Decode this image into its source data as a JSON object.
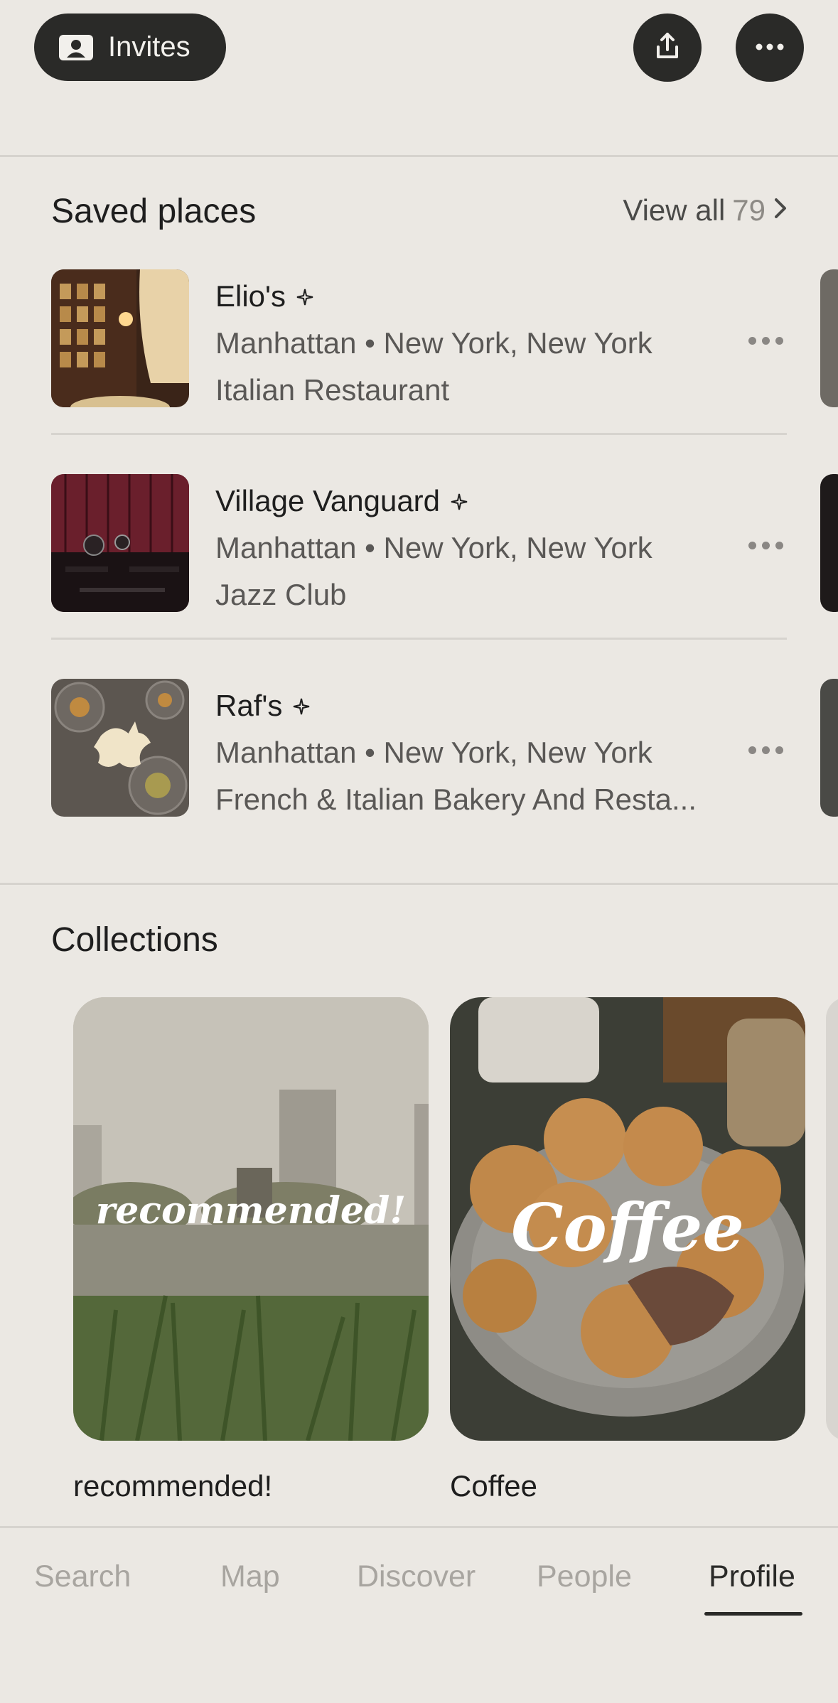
{
  "header": {
    "invites_label": "Invites",
    "icons": [
      "contact-card-icon",
      "share-icon",
      "more-icon"
    ]
  },
  "saved_places": {
    "title": "Saved places",
    "view_all_label": "View all",
    "view_all_count": "79",
    "items": [
      {
        "name": "Elio's",
        "location": "Manhattan • New York, New York",
        "category": "Italian Restaurant"
      },
      {
        "name": "Village Vanguard",
        "location": "Manhattan • New York, New York",
        "category": "Jazz Club"
      },
      {
        "name": "Raf's",
        "location": "Manhattan • New York, New York",
        "category": "French & Italian Bakery And Resta..."
      }
    ]
  },
  "collections": {
    "title": "Collections",
    "items": [
      {
        "cover_text": "recommended!",
        "caption": "recommended!"
      },
      {
        "cover_text": "Coffee",
        "caption": "Coffee"
      }
    ]
  },
  "nav": {
    "items": [
      "Search",
      "Map",
      "Discover",
      "People",
      "Profile"
    ],
    "active": "Profile"
  },
  "colors": {
    "background": "#ebe8e3",
    "button_dark": "#2a2a28",
    "text_secondary": "#5a5856"
  }
}
